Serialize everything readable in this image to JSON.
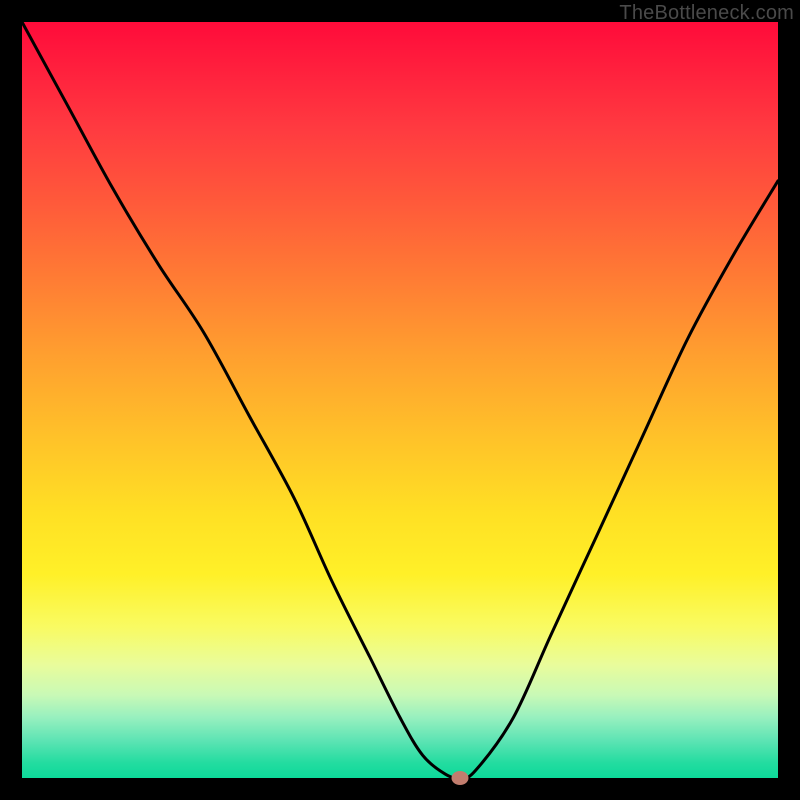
{
  "watermark": "TheBottleneck.com",
  "colors": {
    "frame": "#000000",
    "curve": "#000000",
    "dot": "#c27d6e"
  },
  "chart_data": {
    "type": "line",
    "title": "",
    "xlabel": "",
    "ylabel": "",
    "xlim": [
      0,
      100
    ],
    "ylim": [
      0,
      100
    ],
    "series": [
      {
        "name": "curve",
        "x": [
          0,
          6,
          12,
          18,
          24,
          30,
          36,
          41,
          46,
          50,
          53,
          56,
          58,
          60,
          65,
          70,
          76,
          82,
          88,
          94,
          100
        ],
        "y": [
          100,
          89,
          78,
          68,
          59,
          48,
          37,
          26,
          16,
          8,
          3,
          0.5,
          0,
          1,
          8,
          19,
          32,
          45,
          58,
          69,
          79
        ]
      }
    ],
    "marker": {
      "x": 58,
      "y": 0
    },
    "background_gradient_stops": [
      {
        "pos": 0.0,
        "color": "#ff0b3a"
      },
      {
        "pos": 0.24,
        "color": "#ff5a3a"
      },
      {
        "pos": 0.55,
        "color": "#ffc229"
      },
      {
        "pos": 0.8,
        "color": "#f9fb62"
      },
      {
        "pos": 1.0,
        "color": "#0dd99a"
      }
    ]
  }
}
